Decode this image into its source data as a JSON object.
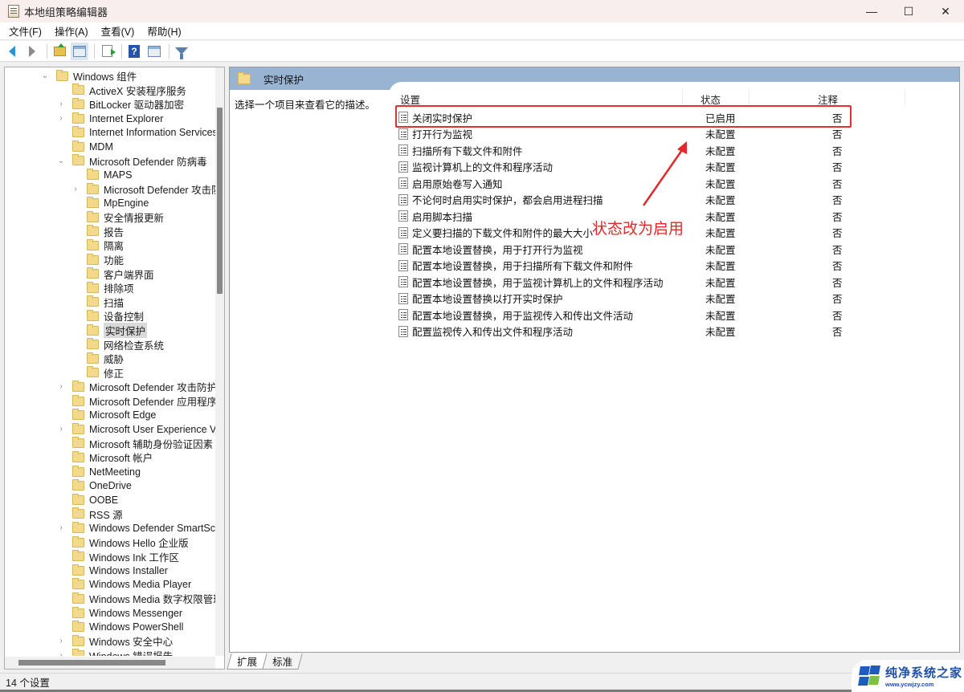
{
  "window": {
    "title": "本地组策略编辑器",
    "controls": {
      "minimize": "—",
      "maximize": "☐",
      "close": "✕"
    }
  },
  "menubar": [
    "文件(F)",
    "操作(A)",
    "查看(V)",
    "帮助(H)"
  ],
  "toolbar": {
    "buttons": [
      "back-icon",
      "forward-icon",
      "up-folder-icon",
      "show-hide-tree-icon",
      "export-list-icon",
      "help-icon",
      "show-action-pane-icon",
      "filter-icon"
    ]
  },
  "tree": {
    "items": [
      {
        "label": "Windows 组件",
        "level": 0,
        "expander": "⌄"
      },
      {
        "label": "ActiveX 安装程序服务",
        "level": 1,
        "expander": ""
      },
      {
        "label": "BitLocker 驱动器加密",
        "level": 1,
        "expander": "›"
      },
      {
        "label": "Internet Explorer",
        "level": 1,
        "expander": "›"
      },
      {
        "label": "Internet Information Services",
        "level": 1,
        "expander": ""
      },
      {
        "label": "MDM",
        "level": 1,
        "expander": ""
      },
      {
        "label": "Microsoft Defender 防病毒",
        "level": 1,
        "expander": "⌄"
      },
      {
        "label": "MAPS",
        "level": 2,
        "expander": ""
      },
      {
        "label": "Microsoft Defender 攻击防",
        "level": 2,
        "expander": "›"
      },
      {
        "label": "MpEngine",
        "level": 2,
        "expander": ""
      },
      {
        "label": "安全情报更新",
        "level": 2,
        "expander": ""
      },
      {
        "label": "报告",
        "level": 2,
        "expander": ""
      },
      {
        "label": "隔离",
        "level": 2,
        "expander": ""
      },
      {
        "label": "功能",
        "level": 2,
        "expander": ""
      },
      {
        "label": "客户端界面",
        "level": 2,
        "expander": ""
      },
      {
        "label": "排除项",
        "level": 2,
        "expander": ""
      },
      {
        "label": "扫描",
        "level": 2,
        "expander": ""
      },
      {
        "label": "设备控制",
        "level": 2,
        "expander": ""
      },
      {
        "label": "实时保护",
        "level": 2,
        "expander": "",
        "selected": true
      },
      {
        "label": "网络检查系统",
        "level": 2,
        "expander": ""
      },
      {
        "label": "威胁",
        "level": 2,
        "expander": ""
      },
      {
        "label": "修正",
        "level": 2,
        "expander": ""
      },
      {
        "label": "Microsoft Defender 攻击防护",
        "level": 1,
        "expander": "›"
      },
      {
        "label": "Microsoft Defender 应用程序防",
        "level": 1,
        "expander": ""
      },
      {
        "label": "Microsoft Edge",
        "level": 1,
        "expander": ""
      },
      {
        "label": "Microsoft User Experience Virt",
        "level": 1,
        "expander": "›"
      },
      {
        "label": "Microsoft 辅助身份验证因素",
        "level": 1,
        "expander": ""
      },
      {
        "label": "Microsoft 帐户",
        "level": 1,
        "expander": ""
      },
      {
        "label": "NetMeeting",
        "level": 1,
        "expander": ""
      },
      {
        "label": "OneDrive",
        "level": 1,
        "expander": ""
      },
      {
        "label": "OOBE",
        "level": 1,
        "expander": ""
      },
      {
        "label": "RSS 源",
        "level": 1,
        "expander": ""
      },
      {
        "label": "Windows Defender SmartScre",
        "level": 1,
        "expander": "›"
      },
      {
        "label": "Windows Hello 企业版",
        "level": 1,
        "expander": ""
      },
      {
        "label": "Windows Ink 工作区",
        "level": 1,
        "expander": ""
      },
      {
        "label": "Windows Installer",
        "level": 1,
        "expander": ""
      },
      {
        "label": "Windows Media Player",
        "level": 1,
        "expander": ""
      },
      {
        "label": "Windows Media 数字权限管理",
        "level": 1,
        "expander": ""
      },
      {
        "label": "Windows Messenger",
        "level": 1,
        "expander": ""
      },
      {
        "label": "Windows PowerShell",
        "level": 1,
        "expander": ""
      },
      {
        "label": "Windows 安全中心",
        "level": 1,
        "expander": "›"
      },
      {
        "label": "Windows 错误报告",
        "level": 1,
        "expander": "›"
      }
    ]
  },
  "details": {
    "header_title": "实时保护",
    "description": "选择一个项目来查看它的描述。",
    "columns": {
      "setting": "设置",
      "state": "状态",
      "comment": "注释"
    },
    "rows": [
      {
        "setting": "关闭实时保护",
        "state": "已启用",
        "comment": "否",
        "highlighted": true
      },
      {
        "setting": "打开行为监视",
        "state": "未配置",
        "comment": "否"
      },
      {
        "setting": "扫描所有下载文件和附件",
        "state": "未配置",
        "comment": "否"
      },
      {
        "setting": "监视计算机上的文件和程序活动",
        "state": "未配置",
        "comment": "否"
      },
      {
        "setting": "启用原始卷写入通知",
        "state": "未配置",
        "comment": "否"
      },
      {
        "setting": "不论何时启用实时保护，都会启用进程扫描",
        "state": "未配置",
        "comment": "否"
      },
      {
        "setting": "启用脚本扫描",
        "state": "未配置",
        "comment": "否"
      },
      {
        "setting": "定义要扫描的下载文件和附件的最大大小",
        "state": "未配置",
        "comment": "否"
      },
      {
        "setting": "配置本地设置替换，用于打开行为监视",
        "state": "未配置",
        "comment": "否"
      },
      {
        "setting": "配置本地设置替换，用于扫描所有下载文件和附件",
        "state": "未配置",
        "comment": "否"
      },
      {
        "setting": "配置本地设置替换，用于监视计算机上的文件和程序活动",
        "state": "未配置",
        "comment": "否"
      },
      {
        "setting": "配置本地设置替换以打开实时保护",
        "state": "未配置",
        "comment": "否"
      },
      {
        "setting": "配置本地设置替换，用于监视传入和传出文件活动",
        "state": "未配置",
        "comment": "否"
      },
      {
        "setting": "配置监视传入和传出文件和程序活动",
        "state": "未配置",
        "comment": "否"
      }
    ]
  },
  "annotation": {
    "text": "状态改为启用",
    "color": "#e02a2a"
  },
  "tabs": [
    {
      "label": "扩展",
      "active": true
    },
    {
      "label": "标准",
      "active": false
    }
  ],
  "statusbar": {
    "text": "14 个设置"
  },
  "watermark": {
    "title": "纯净系统之家",
    "url": "www.ycwjzy.com"
  }
}
